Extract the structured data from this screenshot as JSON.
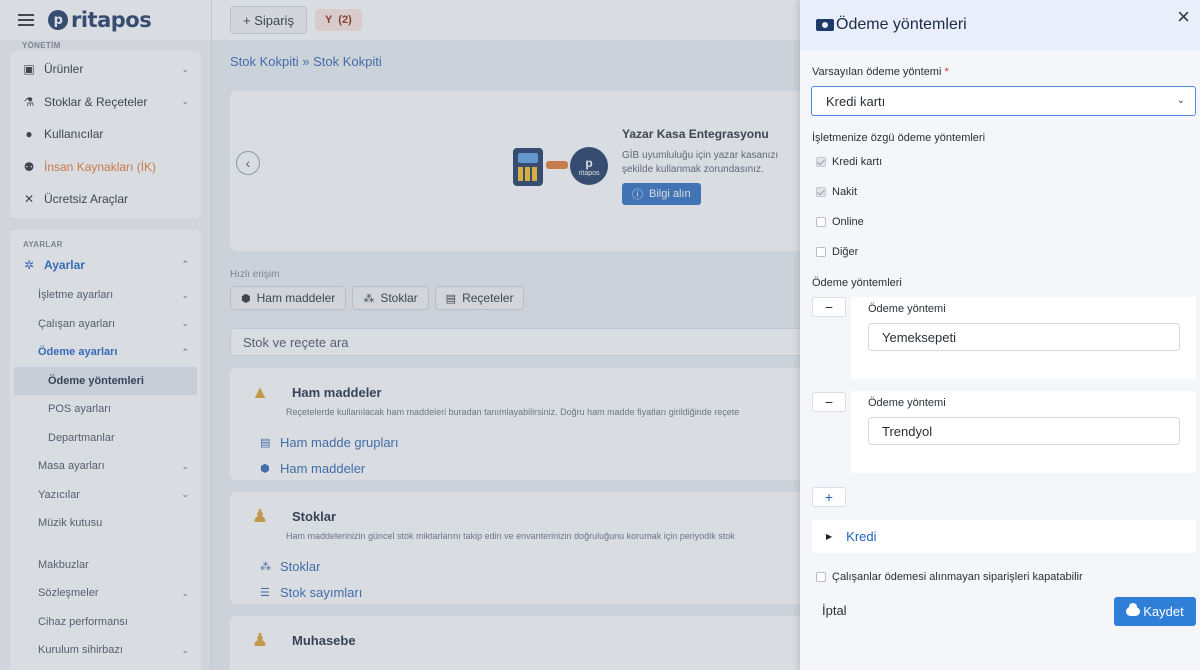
{
  "sidebar": {
    "brand": "ritapos",
    "section_top": "YÖNETİM",
    "items": [
      {
        "label": "Ürünler",
        "icon": "box-icon"
      },
      {
        "label": "Stoklar & Reçeteler",
        "icon": "flask-icon"
      },
      {
        "label": "Kullanıcılar",
        "icon": "user-icon"
      },
      {
        "label": "İnsan Kaynakları (İK)",
        "icon": "people-icon"
      },
      {
        "label": "Ücretsiz Araçlar",
        "icon": "tools-icon"
      }
    ],
    "section_settings": "AYARLAR",
    "settings_label": "Ayarlar",
    "sub": [
      {
        "label": "İşletme ayarları"
      },
      {
        "label": "Çalışan ayarları"
      },
      {
        "label": "Ödeme ayarları"
      },
      {
        "label": "Ödeme yöntemleri"
      },
      {
        "label": "POS ayarları"
      },
      {
        "label": "Departmanlar"
      },
      {
        "label": "Masa ayarları"
      },
      {
        "label": "Yazıcılar"
      },
      {
        "label": "Müzik kutusu"
      },
      {
        "label": "Makbuzlar"
      },
      {
        "label": "Sözleşmeler"
      },
      {
        "label": "Cihaz performansı"
      },
      {
        "label": "Kurulum sihirbazı"
      }
    ]
  },
  "topbar": {
    "order_button": "+ Sipariş",
    "pill_icon": "Y",
    "pill_count": "(2)"
  },
  "breadcrumb": "Stok Kokpiti  »  Stok Kokpiti",
  "banner": {
    "badge": "ritapos",
    "title": "Yazar Kasa Entegrasyonu",
    "text": "GİB uyumluluğu için yazar kasanızı şekilde kullanmak zorundasınız.",
    "button": "Bilgi alın"
  },
  "quick": {
    "label": "Hızlı erişim",
    "buttons": [
      "Ham maddeler",
      "Stoklar",
      "Reçeteler"
    ]
  },
  "search": {
    "placeholder": "Stok ve reçete ara"
  },
  "sections": [
    {
      "title": "Ham maddeler",
      "desc": "Reçetelerde kullanılacak ham maddeleri buradan tanımlayabilirsiniz. Doğru ham madde fiyatları girildiğinde reçete",
      "links": [
        "Ham madde grupları",
        "Ham maddeler"
      ]
    },
    {
      "title": "Stoklar",
      "desc": "Ham maddelerinizin güncel stok miktarlarını takip edin ve envanterinizin doğruluğunu korumak için periyodik stok",
      "links": [
        "Stoklar",
        "Stok sayımları"
      ]
    },
    {
      "title": "Muhasebe",
      "desc": "",
      "links": []
    }
  ],
  "panel": {
    "title": "Ödeme yöntemleri",
    "default_label": "Varsayılan ödeme yöntemi",
    "required_mark": "*",
    "default_value": "Kredi kartı",
    "specific_label": "İşletmenize özgü ödeme yöntemleri",
    "checkboxes": [
      {
        "label": "Kredi kartı",
        "checked": true
      },
      {
        "label": "Nakit",
        "checked": true
      },
      {
        "label": "Online",
        "checked": false
      },
      {
        "label": "Diğer",
        "checked": false
      }
    ],
    "methods_label": "Ödeme yöntemleri",
    "method_field_label": "Ödeme yöntemi",
    "methods": [
      "Yemeksepeti",
      "Trendyol"
    ],
    "remove_symbol": "−",
    "add_symbol": "+",
    "credit_label": "Kredi",
    "staff_close_label": "Çalışanlar ödemesi alınmayan siparişleri kapatabilir",
    "staff_close_checked": false,
    "cancel": "İptal",
    "save": "Kaydet"
  }
}
